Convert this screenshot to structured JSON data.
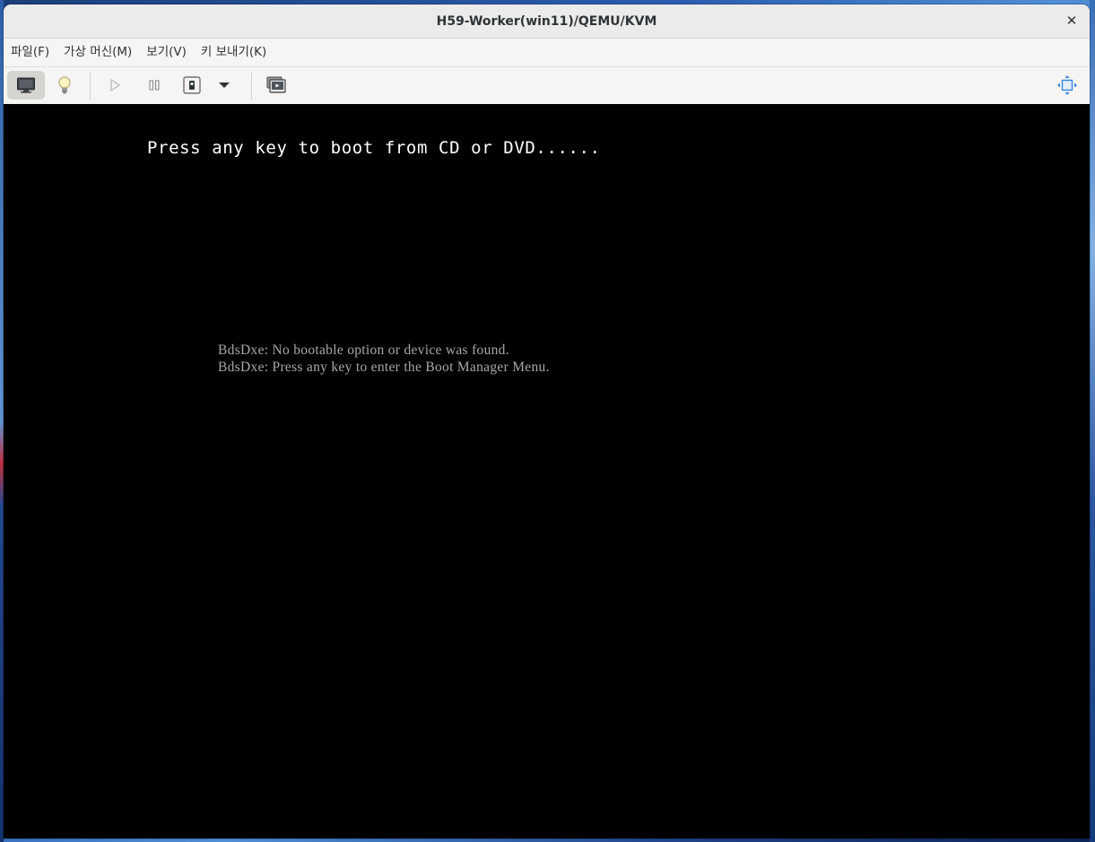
{
  "window": {
    "title": "H59-Worker(win11)/QEMU/KVM",
    "close_glyph": "✕"
  },
  "menubar": {
    "items": [
      {
        "label": "파일(F)"
      },
      {
        "label": "가상 머신(M)"
      },
      {
        "label": "보기(V)"
      },
      {
        "label": "키 보내기(K)"
      }
    ]
  },
  "toolbar": {
    "buttons": [
      {
        "icon": "monitor-icon",
        "active": true
      },
      {
        "icon": "lightbulb-icon",
        "active": false
      },
      {
        "icon": "play-icon",
        "active": false
      },
      {
        "icon": "pause-icon",
        "active": false
      },
      {
        "icon": "power-icon",
        "active": false
      },
      {
        "icon": "chevron-down-icon",
        "active": false
      },
      {
        "icon": "snapshots-icon",
        "active": false
      },
      {
        "icon": "resize-to-vm-icon",
        "active": false
      }
    ]
  },
  "console": {
    "boot_prompt": "Press any key to boot from CD or DVD......",
    "messages": [
      "BdsDxe: No bootable option or device was found.",
      "BdsDxe: Press any key to enter the Boot Manager Menu."
    ]
  }
}
